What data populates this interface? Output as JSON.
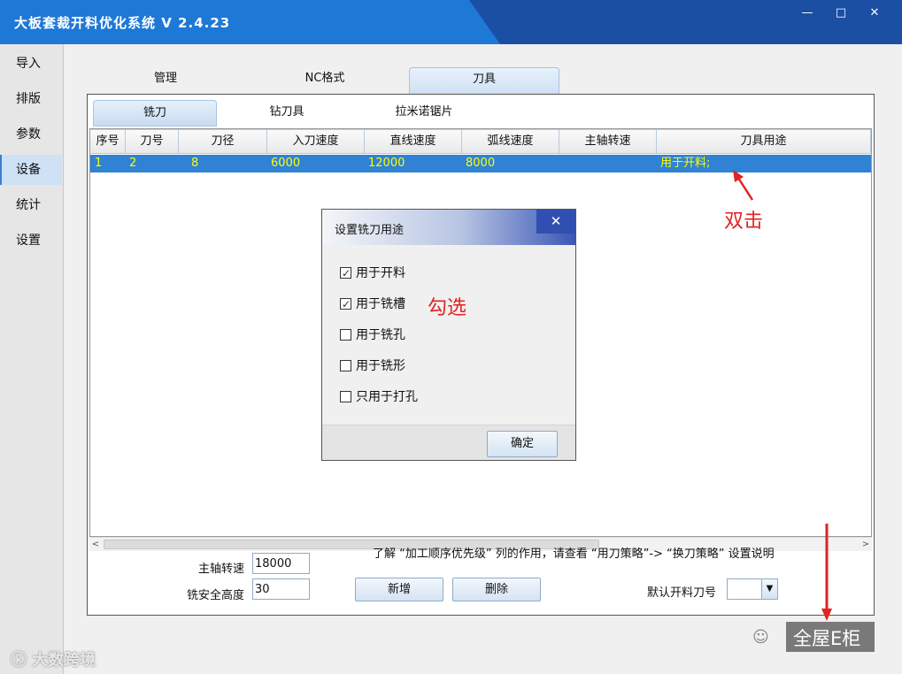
{
  "window": {
    "title": "大板套裁开料优化系统 V 2.4.23",
    "controls": {
      "minimize": "—",
      "maximize": "□",
      "close": "✕"
    }
  },
  "sidebar": {
    "items": [
      {
        "label": "导入"
      },
      {
        "label": "排版"
      },
      {
        "label": "参数"
      },
      {
        "label": "设备",
        "active": true
      },
      {
        "label": "统计"
      },
      {
        "label": "设置"
      }
    ]
  },
  "top_tabs": [
    {
      "label": "管理"
    },
    {
      "label": "NC格式"
    },
    {
      "label": "刀具",
      "active": true
    }
  ],
  "tool_tabs": [
    {
      "label": "铣刀",
      "active": true
    },
    {
      "label": "钻刀具"
    },
    {
      "label": "拉米诺锯片"
    }
  ],
  "grid": {
    "columns": [
      "序号",
      "刀号",
      "刀径",
      "入刀速度",
      "直线速度",
      "弧线速度",
      "主轴转速",
      "刀具用途"
    ],
    "rows": [
      [
        "1",
        "2",
        "8",
        "6000",
        "12000",
        "8000",
        "",
        "用于开料;"
      ]
    ],
    "scroll_left": "<",
    "scroll_right": ">"
  },
  "bottom": {
    "hint": "了解 “加工顺序优先级” 列的作用，请查看 “用刀策略”-> “换刀策略” 设置说明",
    "spindle_label": "主轴转速",
    "spindle_value": "18000",
    "safe_height_label": "铣安全高度",
    "safe_height_value": "30",
    "add_button": "新增",
    "delete_button": "删除",
    "default_tool_label": "默认开料刀号",
    "default_tool_value": ""
  },
  "dialog": {
    "title": "设置铣刀用途",
    "close": "✕",
    "options": [
      {
        "label": "用于开料",
        "checked": true
      },
      {
        "label": "用于铣槽",
        "checked": true
      },
      {
        "label": "用于铣孔",
        "checked": false
      },
      {
        "label": "用于铣形",
        "checked": false
      },
      {
        "label": "只用于打孔",
        "checked": false
      }
    ],
    "confirm_button": "确定"
  },
  "annotations": {
    "double_click": "双击",
    "check": "勾选"
  },
  "watermarks": {
    "left": "大数跨境",
    "right": "全屋E柜"
  },
  "colors": {
    "titlebar": "#1e78d6",
    "selected_row": "#2f82d4",
    "selected_text": "#ffff00",
    "annotation": "#e02323"
  }
}
